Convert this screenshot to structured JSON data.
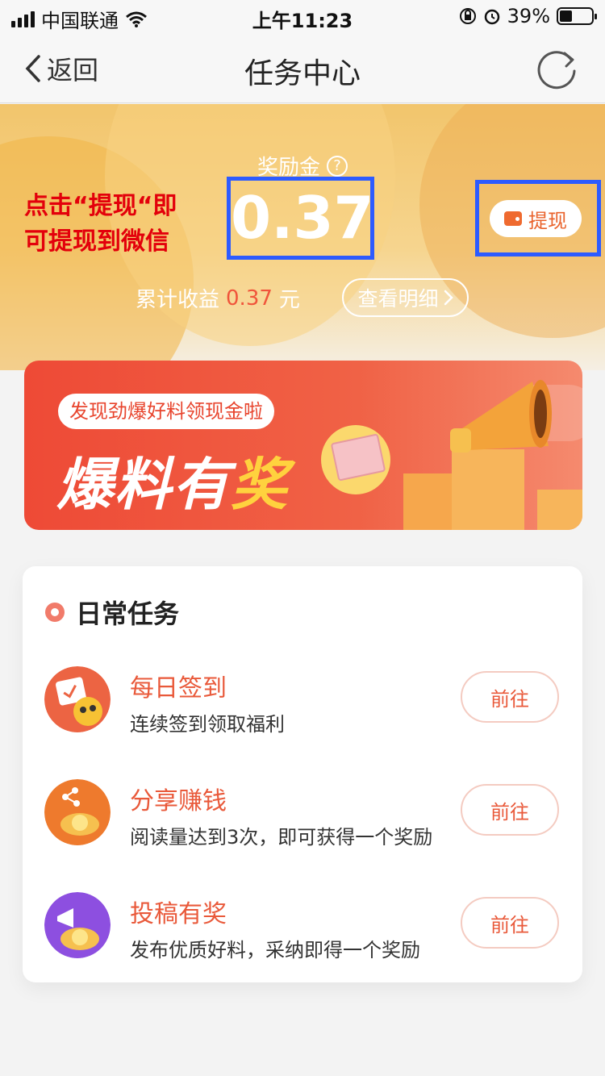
{
  "status_bar": {
    "carrier": "中国联通",
    "time": "上午11:23",
    "battery_percent": "39%",
    "battery_level": 0.39
  },
  "nav": {
    "back_label": "返回",
    "title": "任务中心"
  },
  "reward": {
    "label": "奖励金",
    "amount": "0.37",
    "annotation_line1": "点击“提现“即",
    "annotation_line2": "可提现到微信",
    "withdraw_label": "提现",
    "cumulative_label": "累计收益",
    "cumulative_value": "0.37",
    "cumulative_unit": "元",
    "detail_label": "查看明细"
  },
  "banner": {
    "bubble_text": "发现劲爆好料领现金啦",
    "title_part1": "爆料有",
    "title_part2": "奖"
  },
  "daily_tasks": {
    "title": "日常任务",
    "items": [
      {
        "name": "每日签到",
        "desc": "连续签到领取福利",
        "button": "前往"
      },
      {
        "name": "分享赚钱",
        "desc": "阅读量达到3次，即可获得一个奖励",
        "button": "前往"
      },
      {
        "name": "投稿有奖",
        "desc": "发布优质好料，采纳即得一个奖励",
        "button": "前往"
      }
    ]
  },
  "colors": {
    "accent": "#e9593a",
    "annotation": "#e3000b",
    "highlight_frame": "#2d5bff"
  }
}
